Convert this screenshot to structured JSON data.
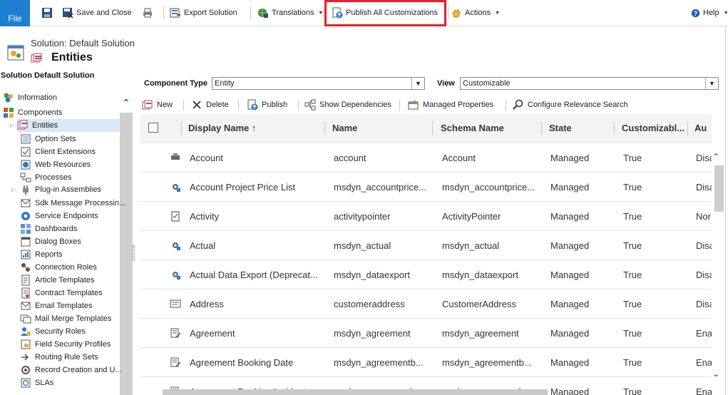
{
  "ribbon": {
    "file": "File",
    "save_close": "Save and Close",
    "export": "Export Solution",
    "translations": "Translations",
    "publish_all": "Publish All Customizations",
    "actions": "Actions",
    "help": "Help"
  },
  "header": {
    "solution": "Solution: Default Solution",
    "title": "Entities"
  },
  "sidebar": {
    "heading": "Solution Default Solution",
    "items": [
      {
        "label": "Information"
      },
      {
        "label": "Components"
      },
      {
        "label": "Entities"
      },
      {
        "label": "Option Sets"
      },
      {
        "label": "Client Extensions"
      },
      {
        "label": "Web Resources"
      },
      {
        "label": "Processes"
      },
      {
        "label": "Plug-in Assemblies"
      },
      {
        "label": "Sdk Message Processin..."
      },
      {
        "label": "Service Endpoints"
      },
      {
        "label": "Dashboards"
      },
      {
        "label": "Dialog Boxes"
      },
      {
        "label": "Reports"
      },
      {
        "label": "Connection Roles"
      },
      {
        "label": "Article Templates"
      },
      {
        "label": "Contract Templates"
      },
      {
        "label": "Email Templates"
      },
      {
        "label": "Mail Merge Templates"
      },
      {
        "label": "Security Roles"
      },
      {
        "label": "Field Security Profiles"
      },
      {
        "label": "Routing Rule Sets"
      },
      {
        "label": "Record Creation and U..."
      },
      {
        "label": "SLAs"
      }
    ]
  },
  "filters": {
    "component_type_label": "Component Type",
    "component_type_value": "Entity",
    "view_label": "View",
    "view_value": "Customizable"
  },
  "toolbar": {
    "new": "New",
    "delete": "Delete",
    "publish": "Publish",
    "show_dependencies": "Show Dependencies",
    "managed_properties": "Managed Properties",
    "configure_relevance": "Configure Relevance Search"
  },
  "grid": {
    "columns": [
      "Display Name ↑",
      "Name",
      "Schema Name",
      "State",
      "Customizabl...",
      "Au"
    ],
    "rows": [
      [
        "Account",
        "account",
        "Account",
        "Managed",
        "True",
        "Disa"
      ],
      [
        "Account Project Price List",
        "msdyn_accountprice...",
        "msdyn_accountprice...",
        "Managed",
        "True",
        "Disa"
      ],
      [
        "Activity",
        "activitypointer",
        "ActivityPointer",
        "Managed",
        "True",
        "Nor"
      ],
      [
        "Actual",
        "msdyn_actual",
        "msdyn_actual",
        "Managed",
        "True",
        "Disa"
      ],
      [
        "Actual Data Export (Deprecat...",
        "msdyn_dataexport",
        "msdyn_dataexport",
        "Managed",
        "True",
        "Disa"
      ],
      [
        "Address",
        "customeraddress",
        "CustomerAddress",
        "Managed",
        "True",
        "Disa"
      ],
      [
        "Agreement",
        "msdyn_agreement",
        "msdyn_agreement",
        "Managed",
        "True",
        "Ena"
      ],
      [
        "Agreement Booking Date",
        "msdyn_agreementb...",
        "msdyn_agreementb...",
        "Managed",
        "True",
        "Ena"
      ],
      [
        "Agreement Booking Incident",
        "msdyn_agreementb...",
        "msdyn_agreementb...",
        "Managed",
        "True",
        "Ena"
      ]
    ]
  },
  "colors": {
    "accent": "#1e7fd0",
    "highlight": "#e4202a"
  }
}
